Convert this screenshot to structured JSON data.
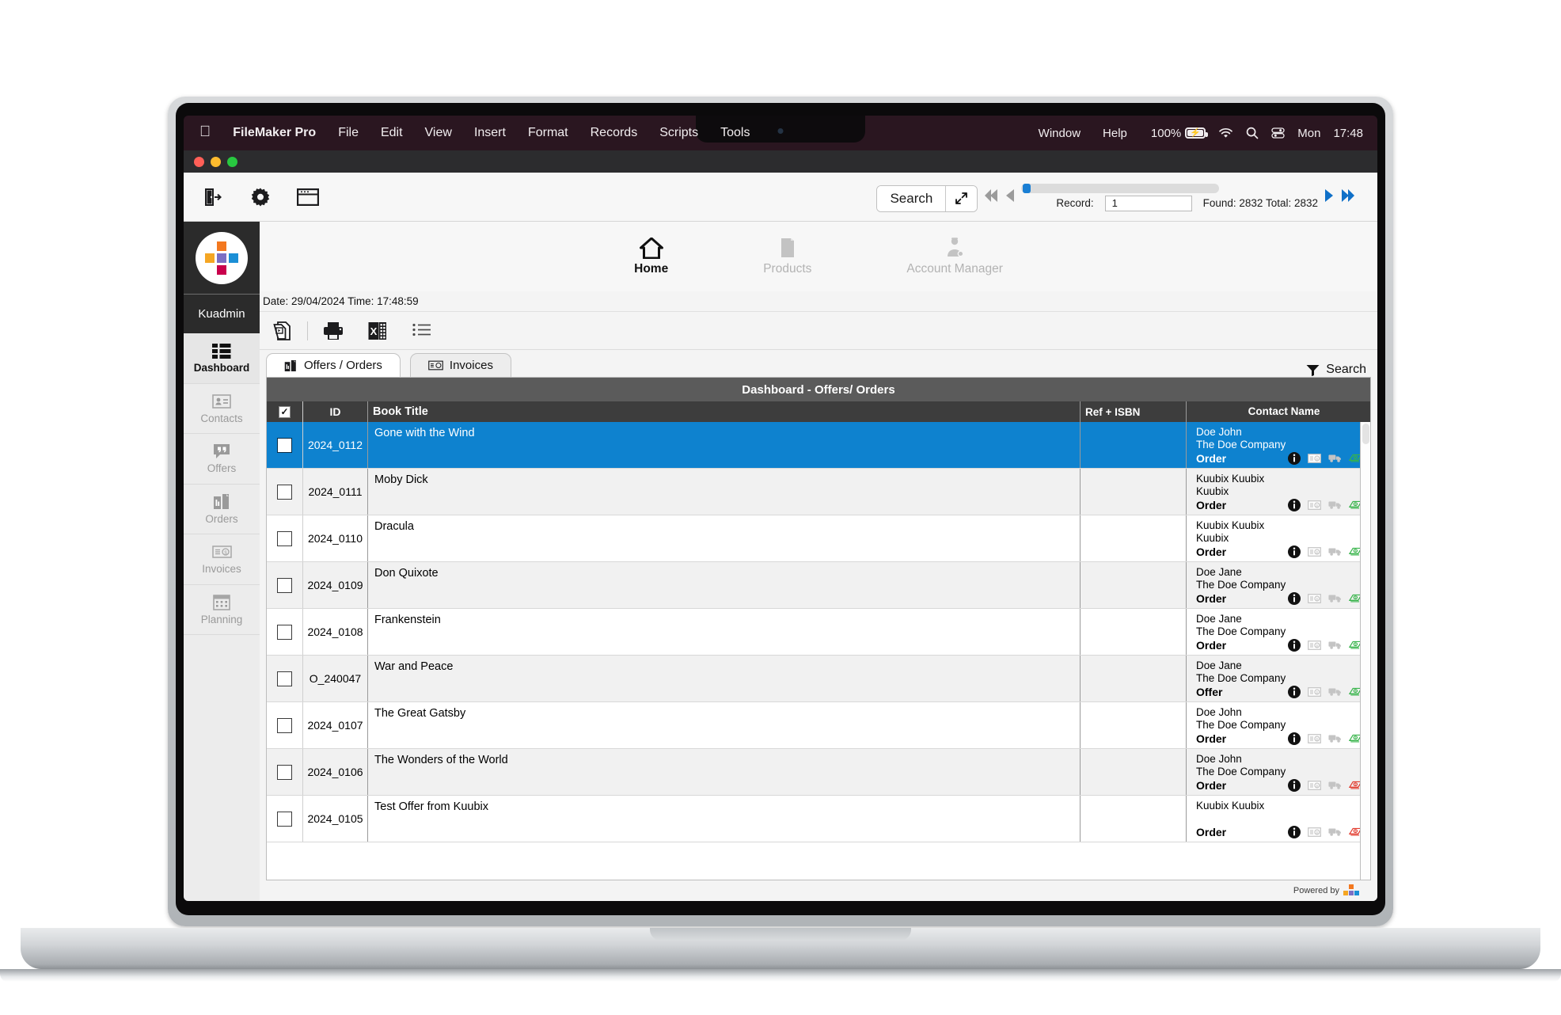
{
  "macos_menubar": {
    "apple_icon": "apple-logo-icon",
    "app_name": "FileMaker Pro",
    "menus": [
      "File",
      "Edit",
      "View",
      "Insert",
      "Format",
      "Records",
      "Scripts",
      "Tools"
    ],
    "right_menus": [
      "Window",
      "Help"
    ],
    "battery_percent": "100%",
    "battery_icon": "battery-charging-icon",
    "wifi_icon": "wifi-icon",
    "search_icon": "spotlight-search-icon",
    "control_center_icon": "control-center-icon",
    "day": "Mon",
    "time": "17:48"
  },
  "window": {
    "traffic_lights": [
      "close",
      "minimize",
      "zoom"
    ]
  },
  "fm_toolbar": {
    "icons": [
      "exit-door-icon",
      "gear-icon",
      "layout-window-icon"
    ],
    "search_label": "Search",
    "expand_icon": "expand-diagonal-icon",
    "nav_first_icon": "first-record-icon",
    "nav_prev_icon": "previous-record-icon",
    "nav_next_icon": "next-record-icon",
    "nav_last_icon": "last-record-icon",
    "record_label": "Record:",
    "record_value": "1",
    "found_total": "Found: 2832 Total: 2832",
    "slider_position_percent": 2
  },
  "sidebar": {
    "logo_icon": "kuadmin-cross-logo",
    "logo_colors": [
      "#f3781f",
      "#f5a623",
      "#7b6fc4",
      "#1b8fd6",
      "#2bb24c",
      "#c9004c"
    ],
    "user": "Kuadmin",
    "items": [
      {
        "label": "Dashboard",
        "icon": "dashboard-grid-icon",
        "active": true
      },
      {
        "label": "Contacts",
        "icon": "contact-card-icon",
        "active": false
      },
      {
        "label": "Offers",
        "icon": "quote-bubble-icon",
        "active": false
      },
      {
        "label": "Orders",
        "icon": "orders-chart-icon",
        "active": false
      },
      {
        "label": "Invoices",
        "icon": "invoice-money-icon",
        "active": false
      },
      {
        "label": "Planning",
        "icon": "calendar-icon",
        "active": false
      }
    ]
  },
  "top_nav": {
    "items": [
      {
        "label": "Home",
        "icon": "home-icon",
        "active": true
      },
      {
        "label": "Products",
        "icon": "product-box-icon",
        "active": false
      },
      {
        "label": "Account Manager",
        "icon": "account-manager-icon",
        "active": false
      }
    ],
    "date_time": "Date: 29/04/2024 Time: 17:48:59"
  },
  "util_bar": {
    "icons": [
      "duplicate-record-icon",
      "print-icon",
      "export-excel-icon",
      "list-view-icon"
    ]
  },
  "tabs": [
    {
      "label": "Offers / Orders",
      "icon": "orders-chart-icon",
      "active": true
    },
    {
      "label": "Invoices",
      "icon": "invoice-money-icon",
      "active": false
    }
  ],
  "search_filter": {
    "label": "Search",
    "icon": "funnel-filter-icon"
  },
  "panel": {
    "title": "Dashboard - Offers/ Orders",
    "columns": {
      "check": "select-all-checkbox",
      "id": "ID",
      "title": "Book Title",
      "ref": "Ref + ISBN",
      "contact": "Contact Name"
    },
    "rows": [
      {
        "id": "2024_0112",
        "title": "Gone with the Wind",
        "ref": "",
        "contact1": "Doe John",
        "contact2": "The Doe Company",
        "status": "Order",
        "selected": true,
        "money_color": "#37b44a"
      },
      {
        "id": "2024_0111",
        "title": "Moby Dick",
        "ref": "",
        "contact1": "Kuubix Kuubix",
        "contact2": "Kuubix",
        "status": "Order",
        "selected": false,
        "money_color": "#37b44a"
      },
      {
        "id": "2024_0110",
        "title": "Dracula",
        "ref": "",
        "contact1": "Kuubix Kuubix",
        "contact2": "Kuubix",
        "status": "Order",
        "selected": false,
        "money_color": "#37b44a"
      },
      {
        "id": "2024_0109",
        "title": "Don Quixote",
        "ref": "",
        "contact1": "Doe Jane",
        "contact2": "The Doe Company",
        "status": "Order",
        "selected": false,
        "money_color": "#37b44a"
      },
      {
        "id": "2024_0108",
        "title": "Frankenstein",
        "ref": "",
        "contact1": "Doe Jane",
        "contact2": "The Doe Company",
        "status": "Order",
        "selected": false,
        "money_color": "#37b44a"
      },
      {
        "id": "O_240047",
        "title": "War and Peace",
        "ref": "",
        "contact1": "Doe Jane",
        "contact2": "The Doe Company",
        "status": "Offer",
        "selected": false,
        "money_color": "#37b44a"
      },
      {
        "id": "2024_0107",
        "title": "The Great Gatsby",
        "ref": "",
        "contact1": "Doe John",
        "contact2": "The Doe Company",
        "status": "Order",
        "selected": false,
        "money_color": "#37b44a"
      },
      {
        "id": "2024_0106",
        "title": "The Wonders of the World",
        "ref": "",
        "contact1": "Doe John",
        "contact2": "The Doe Company",
        "status": "Order",
        "selected": false,
        "money_color": "#e23b2e"
      },
      {
        "id": "2024_0105",
        "title": "Test Offer from Kuubix",
        "ref": "",
        "contact1": "Kuubix Kuubix",
        "contact2": "",
        "status": "Order",
        "selected": false,
        "money_color": "#e23b2e"
      }
    ],
    "row_action_icons": [
      "info-icon",
      "invoice-icon",
      "delivery-truck-icon",
      "money-bill-icon"
    ]
  },
  "footer": {
    "powered_by": "Powered by"
  }
}
